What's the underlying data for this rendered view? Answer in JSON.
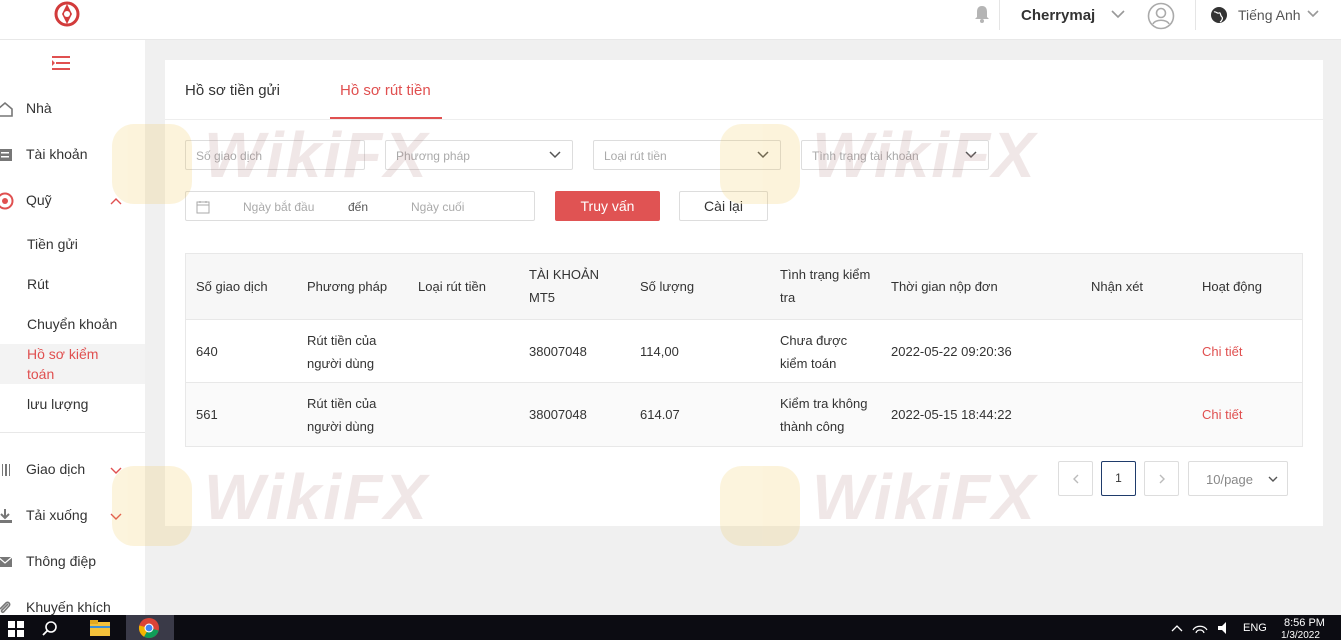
{
  "header": {
    "username": "Cherrymaj",
    "language": "Tiếng Anh"
  },
  "sidebar": {
    "items": [
      {
        "label": "Nhà"
      },
      {
        "label": "Tài khoản"
      },
      {
        "label": "Quỹ"
      },
      {
        "label": "Giao dịch"
      },
      {
        "label": "Tải xuống"
      },
      {
        "label": "Thông điệp"
      },
      {
        "label": "Khuyến khích"
      }
    ],
    "sub_items": [
      {
        "label": "Tiền gửi"
      },
      {
        "label": "Rút"
      },
      {
        "label": "Chuyển khoản"
      },
      {
        "label": "Hồ sơ kiểm toán"
      },
      {
        "label": "lưu lượng"
      }
    ]
  },
  "tabs": {
    "deposit": "Hồ sơ tiền gửi",
    "withdraw": "Hồ sơ rút tiền"
  },
  "filters": {
    "transaction_no": "Số giao dịch",
    "method": "Phương pháp",
    "withdraw_type": "Loại rút tiền",
    "account_status": "Tình trạng tài khoản",
    "start_date": "Ngày bắt đầu",
    "to": "đến",
    "end_date": "Ngày cuối",
    "query_button": "Truy vấn",
    "reset_button": "Cài lại"
  },
  "table": {
    "headers": {
      "txn_no": "Số giao dịch",
      "method": "Phương pháp",
      "withdraw_type": "Loại rút tiền",
      "mt5_line1": "TÀI KHOẢN",
      "mt5_line2": "MT5",
      "amount": "Số lượng",
      "status_line1": "Tình trạng kiểm",
      "status_line2": "tra",
      "submit_time": "Thời gian nộp đơn",
      "remark": "Nhận xét",
      "action": "Hoạt động"
    },
    "rows": [
      {
        "txn_no": "640",
        "method_line1": "Rút tiền của",
        "method_line2": "người dùng",
        "withdraw_type": "",
        "mt5": "38007048",
        "amount": "114,00",
        "status_line1": "Chưa được",
        "status_line2": "kiểm toán",
        "submit_time": "2022-05-22 09:20:36",
        "remark": "",
        "action": "Chi tiết"
      },
      {
        "txn_no": "561",
        "method_line1": "Rút tiền của",
        "method_line2": "người dùng",
        "withdraw_type": "",
        "mt5": "38007048",
        "amount": "614.07",
        "status_line1": "Kiểm tra không",
        "status_line2": "thành công",
        "submit_time": "2022-05-15 18:44:22",
        "remark": "",
        "action": "Chi tiết"
      }
    ]
  },
  "pagination": {
    "current_page": "1",
    "page_size": "10/page"
  },
  "watermark": "WikiFX",
  "taskbar": {
    "lang": "ENG",
    "time": "8:56 PM",
    "date": "1/3/2022"
  },
  "colors": {
    "accent": "#e05353",
    "sidebar_bg": "#ffffff",
    "page_bg": "#f0f0f0",
    "taskbar_bg": "#0c0c12"
  }
}
